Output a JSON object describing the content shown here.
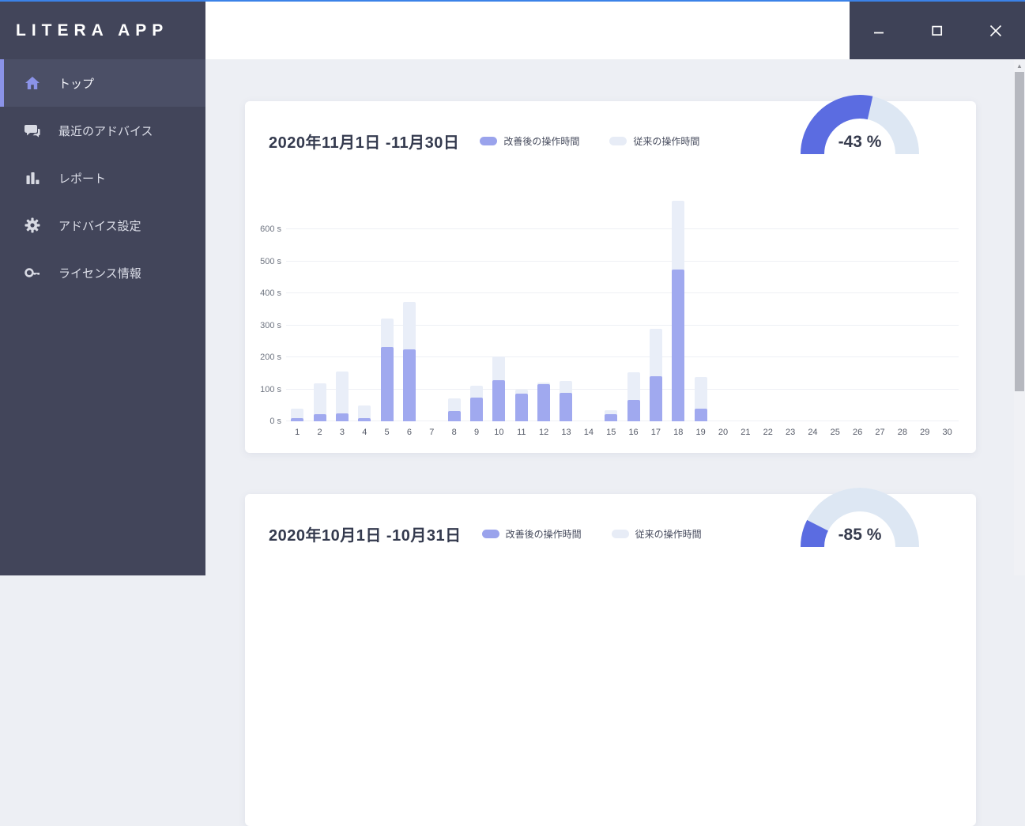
{
  "window": {
    "app_title": "LITERA APP",
    "controls": [
      {
        "name": "minimize"
      },
      {
        "name": "maximize"
      },
      {
        "name": "close"
      }
    ]
  },
  "sidebar": {
    "items": [
      {
        "label": "トップ",
        "icon": "home-icon",
        "active": true
      },
      {
        "label": "最近のアドバイス",
        "icon": "chat-icon",
        "active": false
      },
      {
        "label": "レポート",
        "icon": "bar-chart-icon",
        "active": false
      },
      {
        "label": "アドバイス設定",
        "icon": "gear-icon",
        "active": false
      },
      {
        "label": "ライセンス情報",
        "icon": "key-icon",
        "active": false
      }
    ]
  },
  "cards": [
    {
      "title": "2020年11月1日 -11月30日",
      "legend": [
        {
          "label": "改善後の操作時間",
          "color": "#9aa3ec"
        },
        {
          "label": "従来の操作時間",
          "color": "#e7ecf6"
        }
      ],
      "gauge": {
        "label": "-43 %",
        "percent": -43,
        "fill_fraction": 0.57
      }
    },
    {
      "title": "2020年10月1日 -10月31日",
      "legend": [
        {
          "label": "改善後の操作時間",
          "color": "#9aa3ec"
        },
        {
          "label": "従来の操作時間",
          "color": "#e7ecf6"
        }
      ],
      "gauge": {
        "label": "-85 %",
        "percent": -85,
        "fill_fraction": 0.15
      }
    }
  ],
  "chart_data": {
    "type": "bar",
    "title": "2020年11月1日 -11月30日",
    "stacking": "overlay",
    "categories": [
      "1",
      "2",
      "3",
      "4",
      "5",
      "6",
      "7",
      "8",
      "9",
      "10",
      "11",
      "12",
      "13",
      "14",
      "15",
      "16",
      "17",
      "18",
      "19",
      "20",
      "21",
      "22",
      "23",
      "24",
      "25",
      "26",
      "27",
      "28",
      "29",
      "30"
    ],
    "series": [
      {
        "name": "改善後の操作時間",
        "color": "#a0a9ef",
        "values": [
          10,
          22,
          25,
          10,
          232,
          225,
          0,
          33,
          74,
          128,
          86,
          117,
          88,
          0,
          22,
          67,
          140,
          475,
          40,
          0,
          0,
          0,
          0,
          0,
          0,
          0,
          0,
          0,
          0,
          0
        ]
      },
      {
        "name": "従来の操作時間",
        "color": "#e9eef8",
        "values": [
          40,
          119,
          155,
          49,
          322,
          374,
          0,
          71,
          112,
          202,
          98,
          120,
          125,
          0,
          35,
          152,
          288,
          688,
          138,
          0,
          0,
          0,
          0,
          0,
          0,
          0,
          0,
          0,
          0,
          0
        ]
      }
    ],
    "xlabel": "",
    "ylabel": "",
    "yticks": [
      "0 s",
      "100 s",
      "200 s",
      "300 s",
      "400 s",
      "500 s",
      "600 s"
    ],
    "ylim": [
      0,
      700
    ],
    "grid": "horizontal",
    "legend_position": "top"
  },
  "scrollbar": {
    "up_arrow": "▲"
  },
  "colors": {
    "accent": "#8b93e8",
    "sidebar_bg": "#42455a",
    "titlebar_controls_bg": "#3e4257",
    "main_bg": "#edeff4",
    "bar_improved": "#a0a9ef",
    "bar_conventional": "#e9eef8",
    "gauge_fill": "#5b6ce1",
    "gauge_track": "#dde7f3",
    "window_border": "#3b82e8"
  }
}
